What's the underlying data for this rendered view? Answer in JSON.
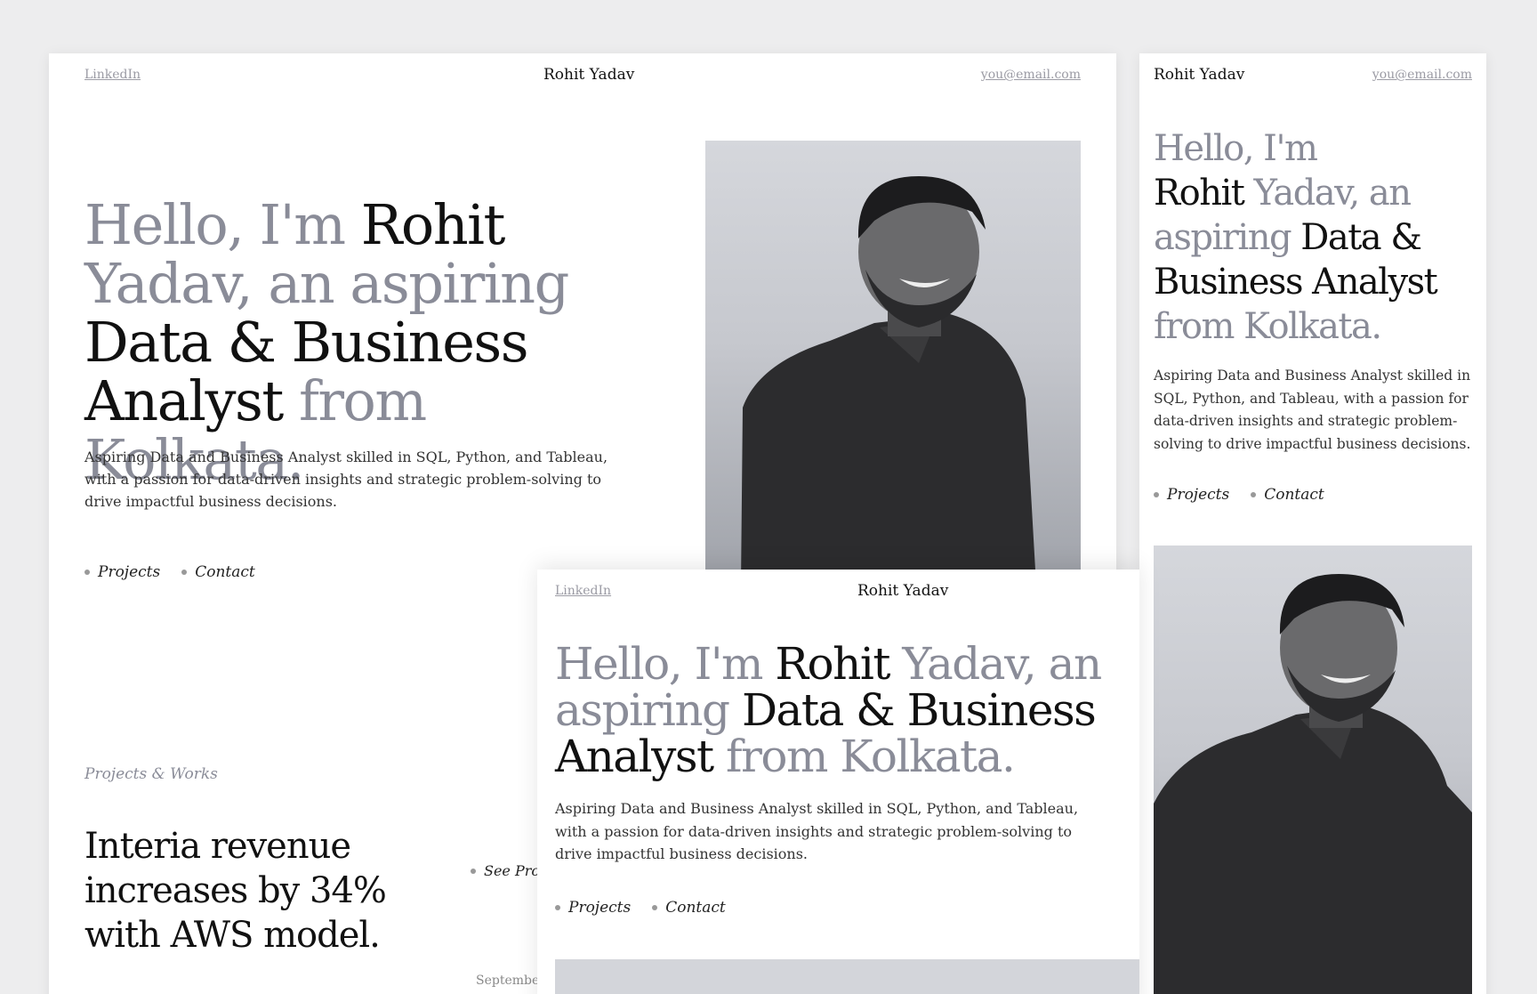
{
  "desktop": {
    "nav": {
      "linkedin": "LinkedIn",
      "brand": "Rohit Yadav",
      "email": "you@email.com"
    },
    "hero": {
      "l1_g": "Hello, I'm ",
      "l1_d": "Rohit",
      "l2_g": "Yadav, an aspiring",
      "l3_d": "Data & Business",
      "l4_d": "Analyst",
      "l4_g": " from Kolkata."
    },
    "description": {
      "line1": "Aspiring Data and Business Analyst skilled in SQL, Python, and Tableau,",
      "line2": "with a passion for data-driven insights and strategic problem-solving to",
      "line3": "drive impactful business decisions."
    },
    "links": {
      "projects": "Projects",
      "contact": "Contact"
    },
    "works": {
      "section_label": "Projects & Works",
      "project_title_l1": "Interia revenue",
      "project_title_l2": "increases by 34%",
      "project_title_l3": "with AWS model.",
      "see_project": "See Proje",
      "date": "September"
    }
  },
  "tablet": {
    "nav": {
      "linkedin": "LinkedIn",
      "brand": "Rohit Yadav"
    },
    "hero": {
      "l1_g": "Hello, I'm ",
      "l1_d": "Rohit",
      "l1_g2": " Yadav, an",
      "l2_g": "aspiring",
      "l2_d": " Data & Business",
      "l3_d": "Analyst",
      "l3_g": " from Kolkata."
    },
    "description": {
      "line1": "Aspiring Data and Business Analyst skilled in SQL, Python, and Tableau,",
      "line2": "with a passion for data-driven insights and strategic problem-solving to",
      "line3": "drive impactful business decisions."
    },
    "links": {
      "projects": "Projects",
      "contact": "Contact"
    }
  },
  "mobile": {
    "nav": {
      "brand": "Rohit Yadav",
      "email": "you@email.com"
    },
    "hero": {
      "l1_g": "Hello, I'm",
      "l2_d": "Rohit",
      "l2_g": " Yadav, an",
      "l3_g": "aspiring",
      "l3_d": " Data &",
      "l4_d": "Business Analyst",
      "l5_g": "from Kolkata."
    },
    "description": {
      "line1": "Aspiring Data and Business Analyst skilled in",
      "line2": "SQL, Python, and Tableau, with a passion for",
      "line3": "data-driven insights and strategic problem-",
      "line4": "solving to drive impactful business decisions."
    },
    "links": {
      "projects": "Projects",
      "contact": "Contact"
    }
  },
  "colors": {
    "background": "#ededee",
    "card": "#ffffff",
    "muted_text": "#8a8c98",
    "dark_text": "#111111",
    "photo_bg": "#c6c8ce"
  }
}
